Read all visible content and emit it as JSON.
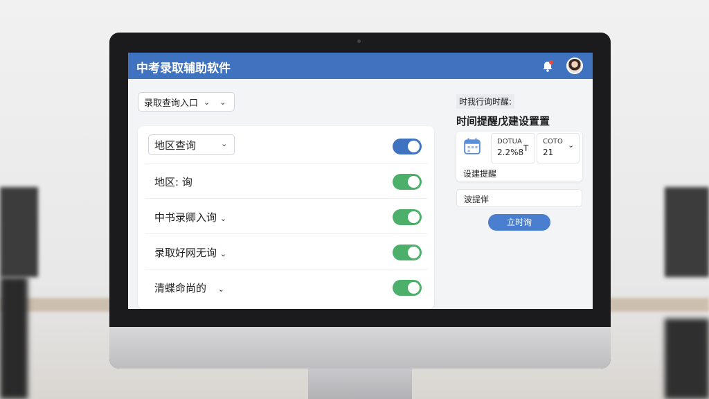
{
  "app": {
    "title": "中考录取辅助软件"
  },
  "header": {
    "notification_icon": "bell-icon",
    "avatar": "user-avatar"
  },
  "entry_select": {
    "label": "录取查询入口"
  },
  "list": {
    "items": [
      {
        "label": "地区查询",
        "style": "dropdown",
        "toggle_on": true,
        "toggle_color": "#3f73bf"
      },
      {
        "label": "地区: 询",
        "style": "text",
        "toggle_on": true,
        "toggle_color": "#4caf6a"
      },
      {
        "label": "中书录卿入询",
        "style": "text-chevron",
        "toggle_on": true,
        "toggle_color": "#4caf6a"
      },
      {
        "label": "录取好网无询",
        "style": "text-chevron",
        "toggle_on": true,
        "toggle_color": "#4caf6a"
      },
      {
        "label": "清蝶命尚的",
        "style": "text-chevron",
        "toggle_on": true,
        "toggle_color": "#4caf6a"
      }
    ]
  },
  "reminder": {
    "top_label": "时我行询时醒:",
    "heading": "时间提醒戊建设置置",
    "date_small": "DOTUA",
    "date_value": "2.2%8",
    "t_label": "T",
    "time_small": "COTO",
    "time_value": "21",
    "set_reminder_label": "设建提醒",
    "note_label": "波提佯",
    "confirm_label": "立时询"
  },
  "colors": {
    "titlebar": "#3f73bf",
    "toggle_blue": "#3f73bf",
    "toggle_green": "#4caf6a",
    "button": "#4a7fd0"
  }
}
